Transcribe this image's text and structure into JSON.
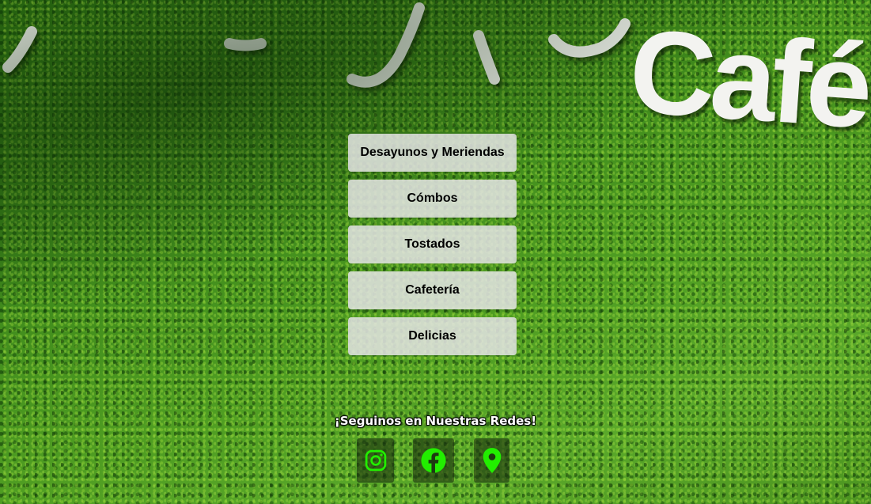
{
  "brand": {
    "sign_word": "Café"
  },
  "menu": {
    "items": [
      {
        "label": "Desayunos y Meriendas"
      },
      {
        "label": "Cómbos"
      },
      {
        "label": "Tostados"
      },
      {
        "label": "Cafetería"
      },
      {
        "label": "Delicias"
      }
    ]
  },
  "social": {
    "title": "¡Seguinos en Nuestras Redes!",
    "icons": [
      "instagram-icon",
      "facebook-icon",
      "location-pin-icon"
    ],
    "icon_color": "#22ee00"
  }
}
